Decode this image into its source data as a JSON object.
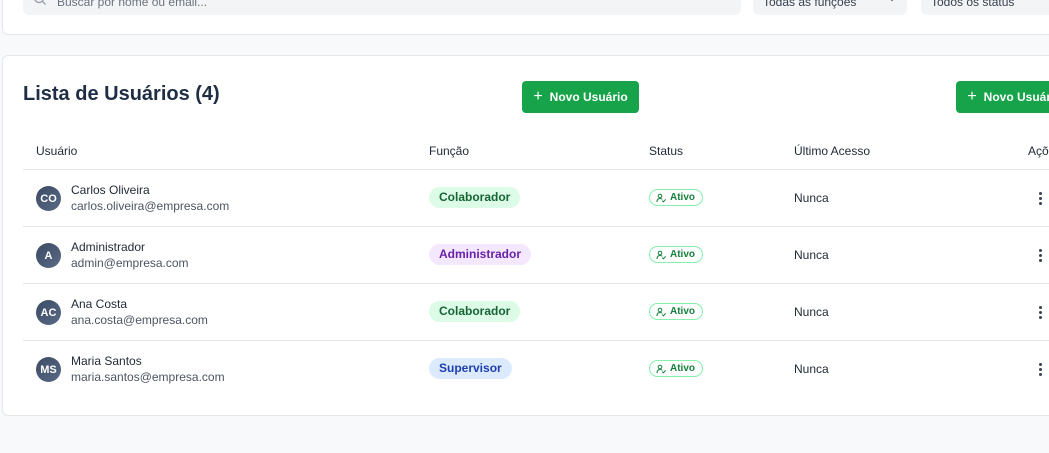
{
  "filters": {
    "search_placeholder": "Buscar por nome ou email...",
    "role_select": "Todas as funções",
    "status_select": "Todos os status"
  },
  "list": {
    "title": "Lista de Usuários (4)",
    "new_user_label": "Novo Usuário",
    "columns": {
      "user": "Usuário",
      "role": "Função",
      "status": "Status",
      "last_access": "Último Acesso",
      "actions": "Ações"
    },
    "users": [
      {
        "initials": "CO",
        "name": "Carlos Oliveira",
        "email": "carlos.oliveira@empresa.com",
        "role": "Colaborador",
        "status": "Ativo",
        "last_access": "Nunca"
      },
      {
        "initials": "A",
        "name": "Administrador",
        "email": "admin@empresa.com",
        "role": "Administrador",
        "status": "Ativo",
        "last_access": "Nunca"
      },
      {
        "initials": "AC",
        "name": "Ana Costa",
        "email": "ana.costa@empresa.com",
        "role": "Colaborador",
        "status": "Ativo",
        "last_access": "Nunca"
      },
      {
        "initials": "MS",
        "name": "Maria Santos",
        "email": "maria.santos@empresa.com",
        "role": "Supervisor",
        "status": "Ativo",
        "last_access": "Nunca"
      }
    ]
  },
  "colors": {
    "primary_button": "#16a34a",
    "colaborador_badge": "#dcfce7",
    "administrador_badge": "#f3e8ff",
    "supervisor_badge": "#dbeafe",
    "active_status": "#15803d"
  },
  "icons": {
    "search": "search-icon",
    "chevron": "chevron-down-icon",
    "plus": "plus-icon",
    "user_check": "user-check-icon",
    "more": "more-vertical-icon"
  }
}
